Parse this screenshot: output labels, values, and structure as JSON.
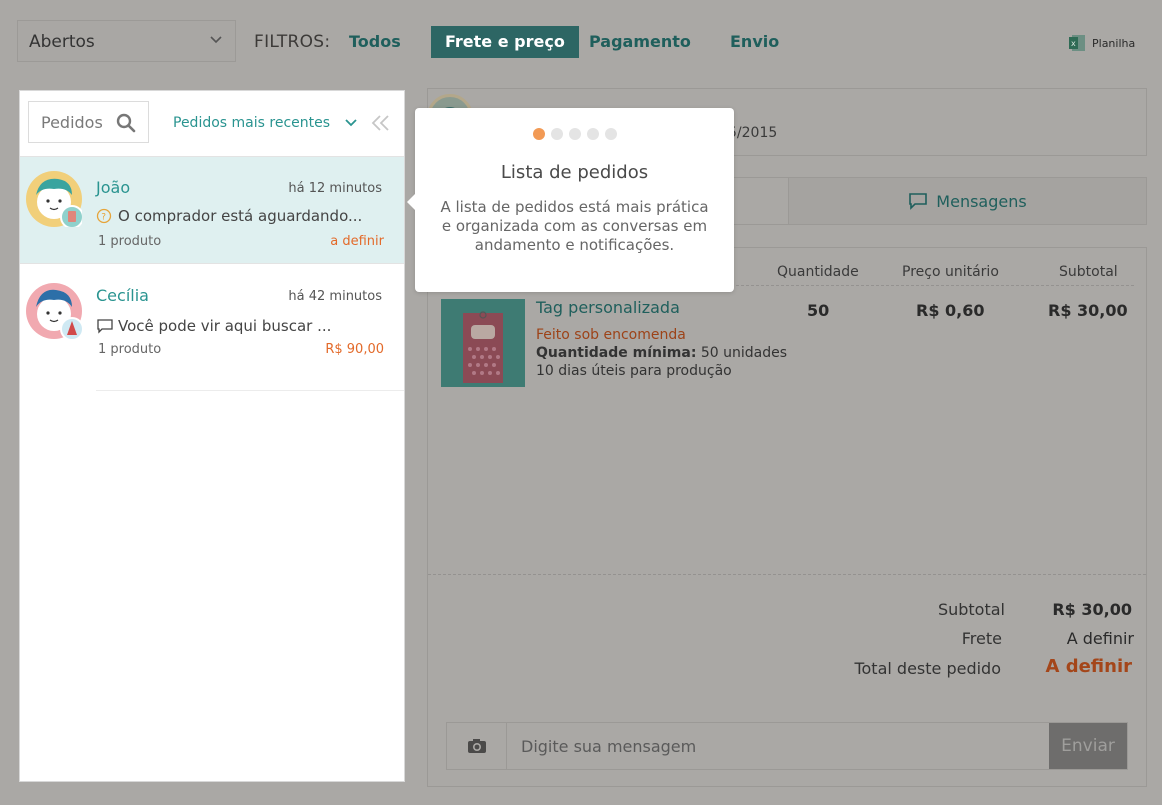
{
  "topbar": {
    "status_value": "Abertos",
    "filters_label": "FILTROS:",
    "filters": [
      {
        "label": "Todos"
      },
      {
        "label": "Frete e preço"
      },
      {
        "label": "Pagamento"
      },
      {
        "label": "Envio"
      }
    ],
    "active_filter": "Frete e preço",
    "planilha_label": "Planilha"
  },
  "left": {
    "search_placeholder": "Pedidos",
    "sort_label": "Pedidos mais recentes",
    "orders": [
      {
        "name": "João",
        "time": "há 12 minutos",
        "message": "O comprador está aguardando...",
        "count": "1 produto",
        "price": "a definir",
        "status_icon": "question-circle-icon"
      },
      {
        "name": "Cecília",
        "time": "há 42 minutos",
        "message": "Você pode vir aqui buscar ...",
        "count": "1 produto",
        "price": "R$ 90,00",
        "status_icon": "speech-bubble-icon"
      }
    ]
  },
  "right": {
    "header_date": "5/2015",
    "tab_messages": "Mensagens",
    "table_headers": {
      "quantity": "Quantidade",
      "unit_price": "Preço unitário",
      "subtotal": "Subtotal"
    },
    "product": {
      "name": "Tag personalizada",
      "made_to_order": "Feito sob encomenda",
      "min_label": "Quantidade mínima:",
      "min_value": "50 unidades",
      "days": "10 dias úteis para produção",
      "quantity": "50",
      "unit_price": "R$ 0,60",
      "subtotal": "R$ 30,00"
    },
    "totals": {
      "subtotal_label": "Subtotal",
      "subtotal_value": "R$ 30,00",
      "shipping_label": "Frete",
      "shipping_value": "A definir",
      "total_label": "Total deste pedido",
      "total_value": "A definir"
    },
    "message_placeholder": "Digite sua mensagem",
    "send_label": "Enviar"
  },
  "tooltip": {
    "step": 1,
    "steps": 5,
    "title": "Lista de pedidos",
    "body": "A lista de pedidos está mais prática e organizada com as conversas em andamento e notificações."
  },
  "colors": {
    "accent": "#2a9490",
    "price": "#e36a2a",
    "active_filter_bg": "#2d6664",
    "active_dot": "#f29a55",
    "overlay_bg": "#aaa8a5"
  }
}
